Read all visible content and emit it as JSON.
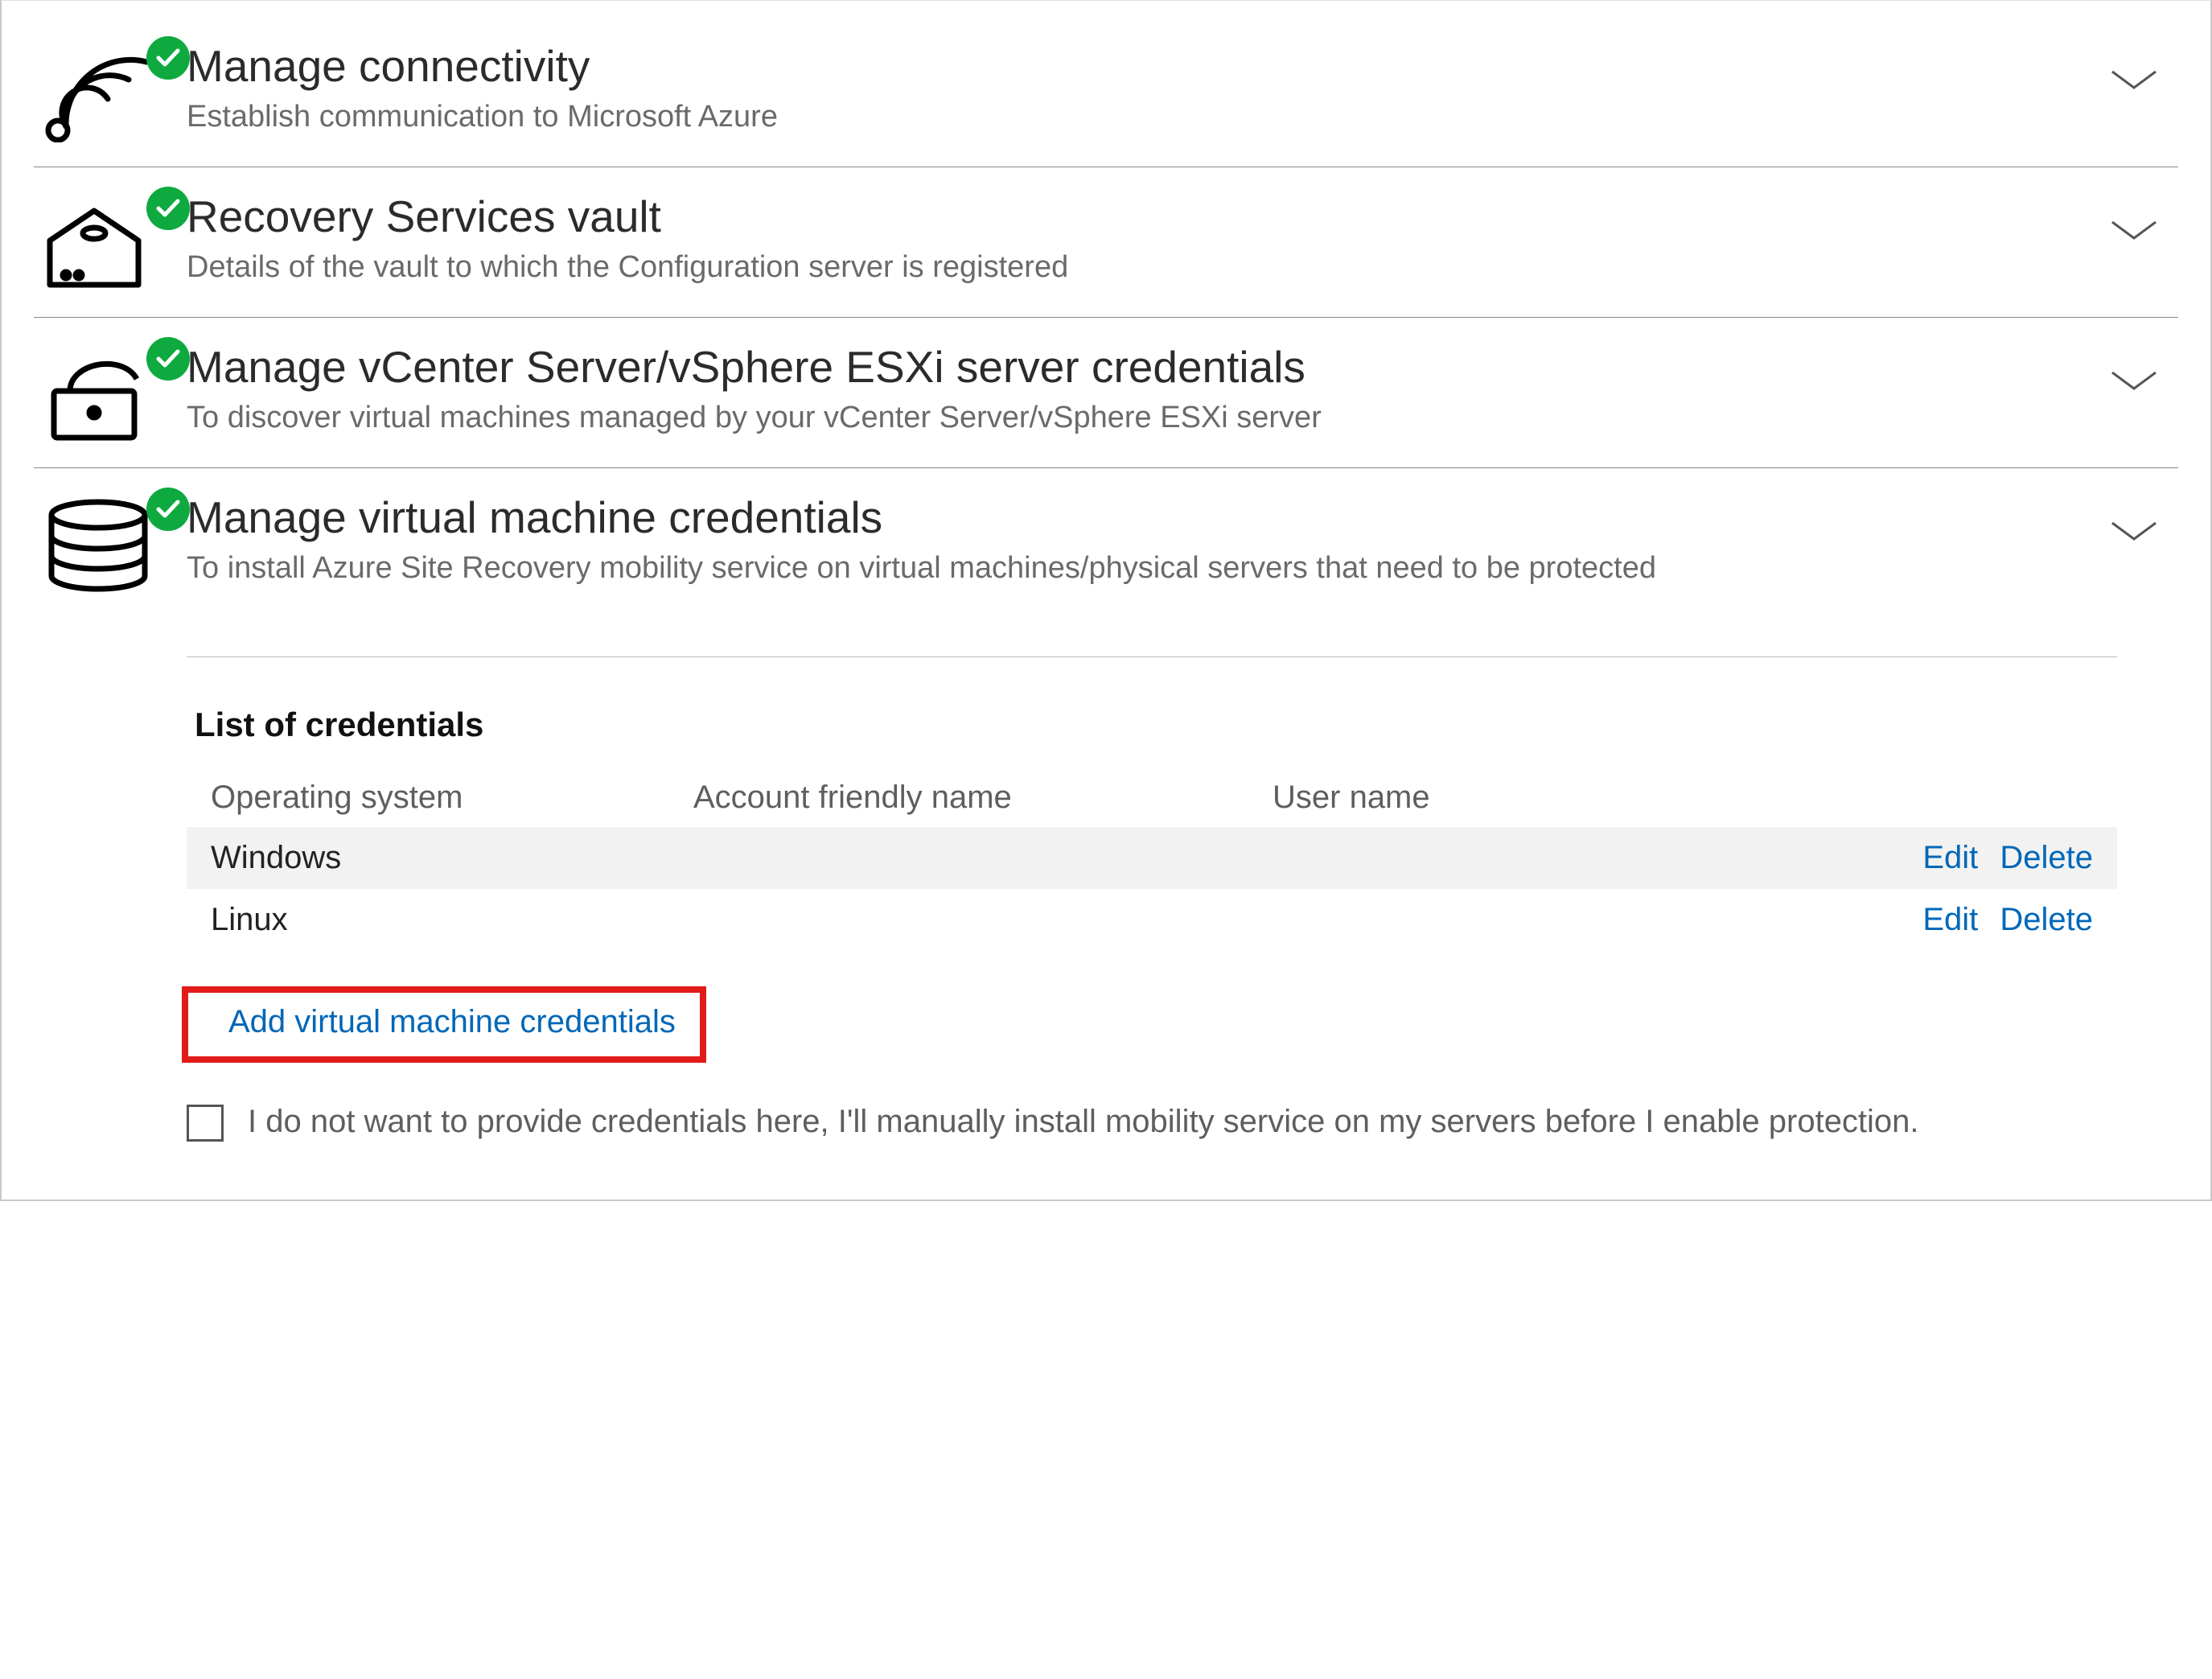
{
  "sections": [
    {
      "title": "Manage connectivity",
      "desc": "Establish communication to Microsoft Azure",
      "icon": "connectivity-icon"
    },
    {
      "title": "Recovery Services vault",
      "desc": "Details of the vault to which the Configuration server is registered",
      "icon": "vault-icon"
    },
    {
      "title": "Manage vCenter Server/vSphere ESXi server credentials",
      "desc": "To discover virtual machines managed by your vCenter Server/vSphere ESXi server",
      "icon": "lock-icon"
    },
    {
      "title": "Manage virtual machine credentials",
      "desc": "To install Azure Site Recovery mobility service on virtual machines/physical servers that need to be protected",
      "icon": "database-icon"
    }
  ],
  "credentials": {
    "list_title": "List of credentials",
    "columns": {
      "os": "Operating system",
      "friendly": "Account friendly name",
      "user": "User name"
    },
    "rows": [
      {
        "os": "Windows",
        "friendly": "",
        "user": ""
      },
      {
        "os": "Linux",
        "friendly": "",
        "user": ""
      }
    ],
    "actions": {
      "edit": "Edit",
      "delete": "Delete"
    },
    "add_label": "Add virtual machine credentials",
    "opt_out_label": "I do not want to provide credentials here, I'll manually install mobility service on my servers before I enable protection."
  }
}
